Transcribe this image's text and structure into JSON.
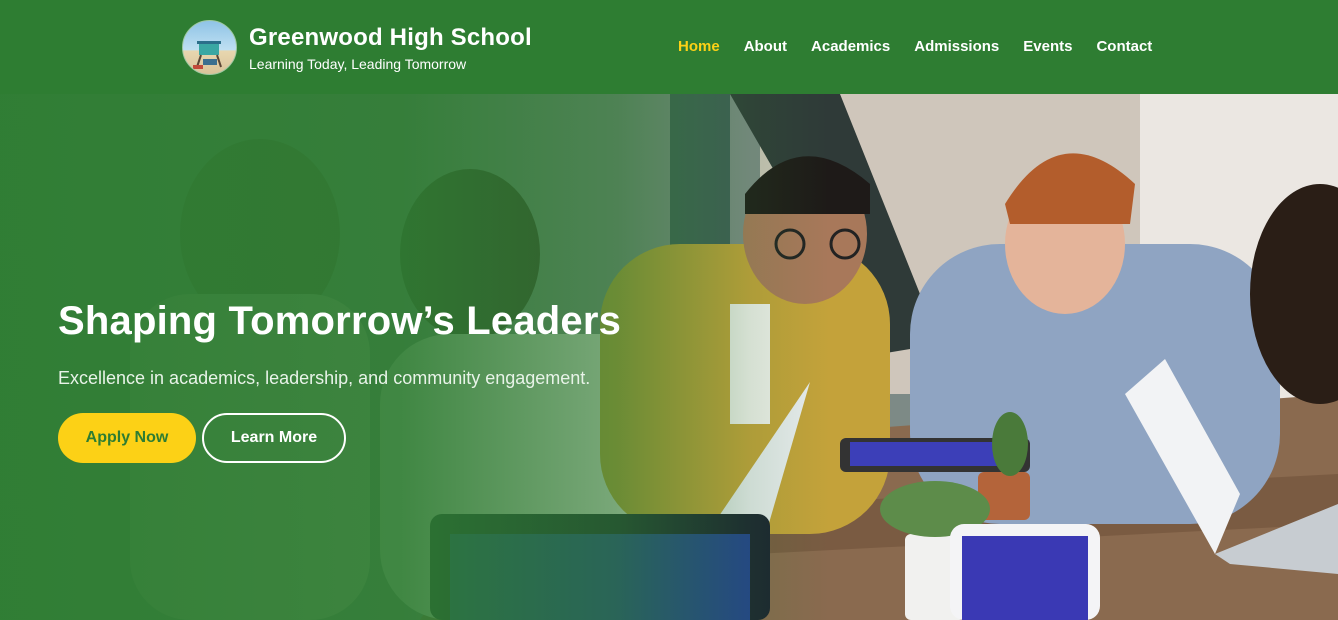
{
  "header": {
    "school_name": "Greenwood High School",
    "tagline": "Learning Today, Leading Tomorrow",
    "logo_icon": "school-logo-lifeguard-tower",
    "nav": [
      {
        "label": "Home",
        "active": true
      },
      {
        "label": "About",
        "active": false
      },
      {
        "label": "Academics",
        "active": false
      },
      {
        "label": "Admissions",
        "active": false
      },
      {
        "label": "Events",
        "active": false
      },
      {
        "label": "Contact",
        "active": false
      }
    ]
  },
  "hero": {
    "title": "Shaping Tomorrow’s Leaders",
    "subtitle": "Excellence in academics, leadership, and community engagement.",
    "primary_button": "Apply Now",
    "secondary_button": "Learn More"
  },
  "colors": {
    "brand_green": "#2e7d32",
    "accent_yellow": "#fcd116",
    "text_white": "#ffffff"
  }
}
